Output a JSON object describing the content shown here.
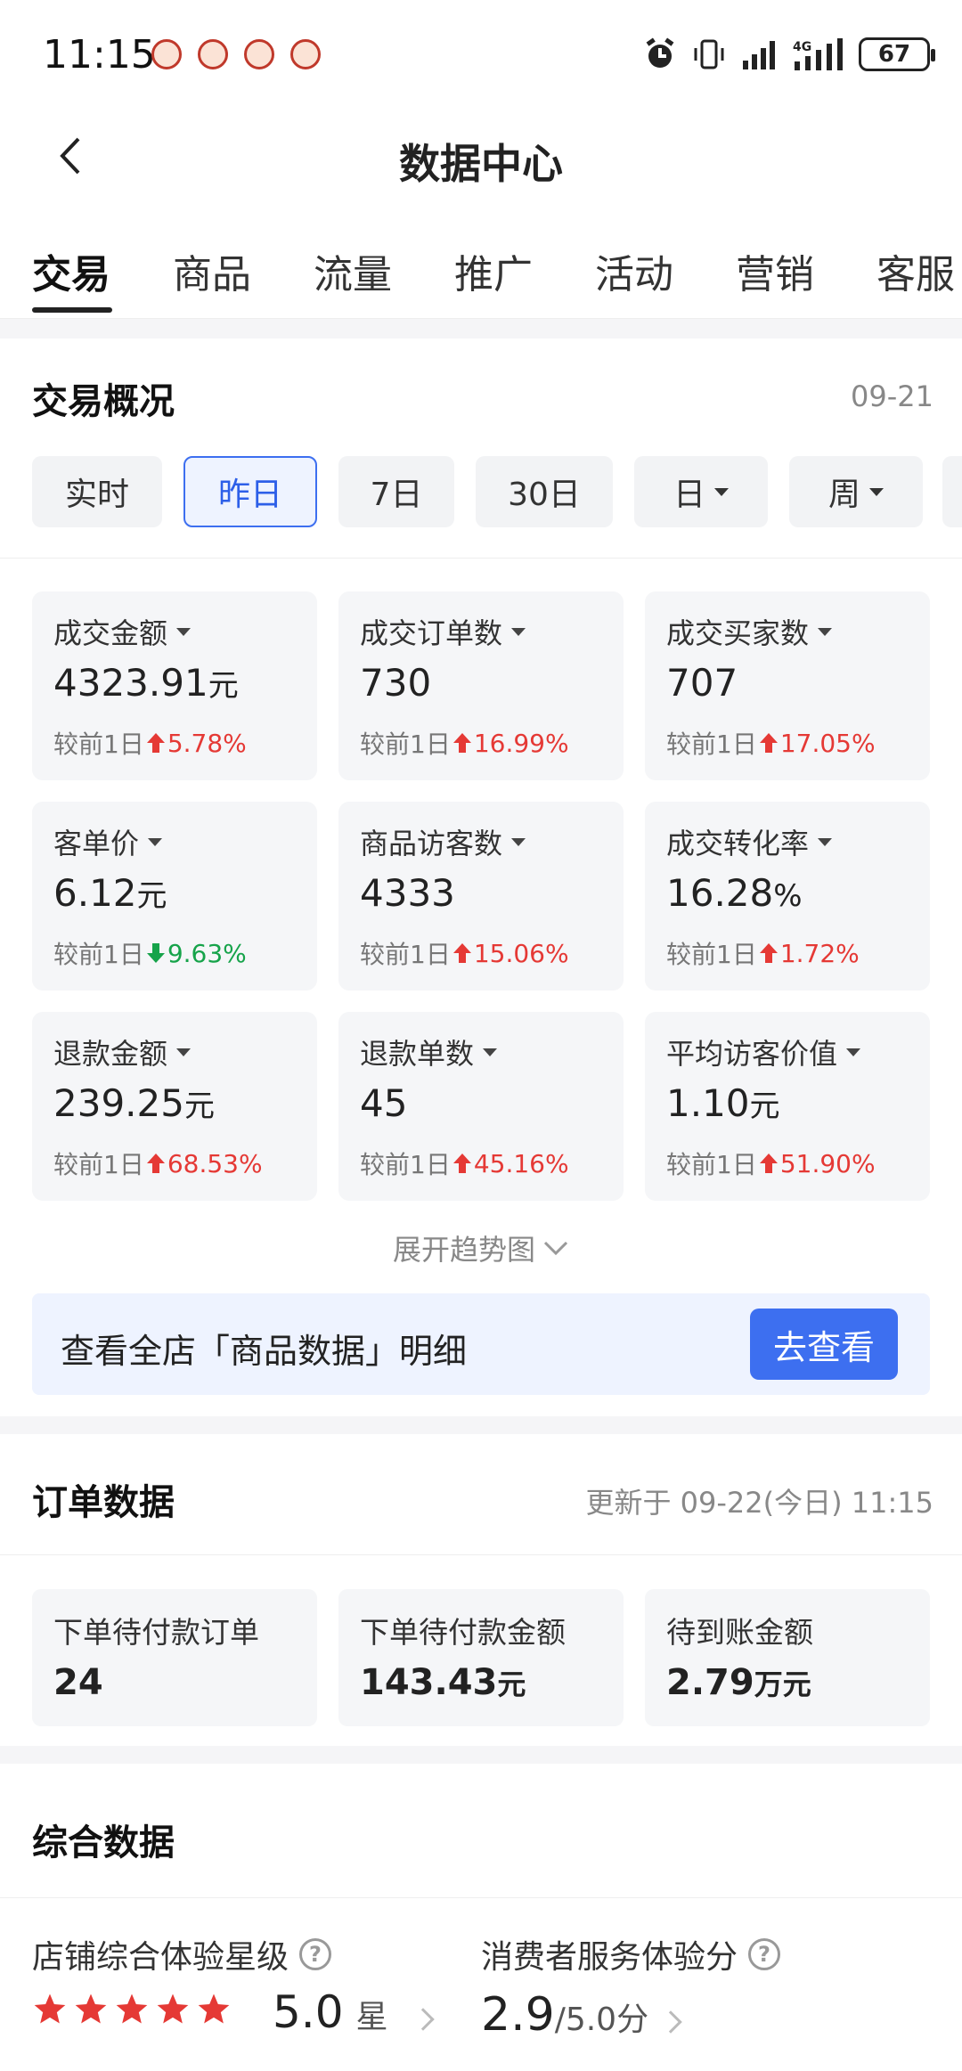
{
  "status_bar": {
    "time": "11:15",
    "battery": "67",
    "network": "4G"
  },
  "header": {
    "title": "数据中心"
  },
  "tabs": [
    {
      "label": "交易",
      "active": true
    },
    {
      "label": "商品"
    },
    {
      "label": "流量"
    },
    {
      "label": "推广"
    },
    {
      "label": "活动"
    },
    {
      "label": "营销"
    },
    {
      "label": "客服"
    }
  ],
  "trade_overview": {
    "title": "交易概况",
    "date": "09-21",
    "chips": [
      "实时",
      "昨日",
      "7日",
      "30日",
      "日",
      "周"
    ],
    "active_chip": "昨日",
    "metrics": [
      {
        "label": "成交金额",
        "value": "4323.91",
        "unit": "元",
        "compare": "较前1日",
        "change": "5.78%",
        "direction": "up"
      },
      {
        "label": "成交订单数",
        "value": "730",
        "unit": "",
        "compare": "较前1日",
        "change": "16.99%",
        "direction": "up"
      },
      {
        "label": "成交买家数",
        "value": "707",
        "unit": "",
        "compare": "较前1日",
        "change": "17.05%",
        "direction": "up"
      },
      {
        "label": "客单价",
        "value": "6.12",
        "unit": "元",
        "compare": "较前1日",
        "change": "9.63%",
        "direction": "down"
      },
      {
        "label": "商品访客数",
        "value": "4333",
        "unit": "",
        "compare": "较前1日",
        "change": "15.06%",
        "direction": "up"
      },
      {
        "label": "成交转化率",
        "value": "16.28",
        "unit": "%",
        "compare": "较前1日",
        "change": "1.72%",
        "direction": "up"
      },
      {
        "label": "退款金额",
        "value": "239.25",
        "unit": "元",
        "compare": "较前1日",
        "change": "68.53%",
        "direction": "up"
      },
      {
        "label": "退款单数",
        "value": "45",
        "unit": "",
        "compare": "较前1日",
        "change": "45.16%",
        "direction": "up"
      },
      {
        "label": "平均访客价值",
        "value": "1.10",
        "unit": "元",
        "compare": "较前1日",
        "change": "51.90%",
        "direction": "up"
      }
    ],
    "expand_label": "展开趋势图",
    "banner_text": "查看全店「商品数据」明细",
    "banner_button": "去查看"
  },
  "order_data": {
    "title": "订单数据",
    "updated": "更新于 09-22(今日) 11:15",
    "items": [
      {
        "label": "下单待付款订单",
        "value": "24",
        "unit": ""
      },
      {
        "label": "下单待付款金额",
        "value": "143.43",
        "unit": "元"
      },
      {
        "label": "待到账金额",
        "value": "2.79",
        "unit": "万元"
      }
    ]
  },
  "overall_data": {
    "title": "综合数据",
    "store_rating_label": "店铺综合体验星级",
    "store_rating_value": "5.0",
    "store_rating_unit": "星",
    "stars": 5,
    "service_score_label": "消费者服务体验分",
    "service_score_value": "2.9",
    "service_score_unit": "/5.0分"
  },
  "colors": {
    "accent": "#3d6ff0",
    "up": "#e53935",
    "down": "#16a34a",
    "star": "#e53935"
  }
}
